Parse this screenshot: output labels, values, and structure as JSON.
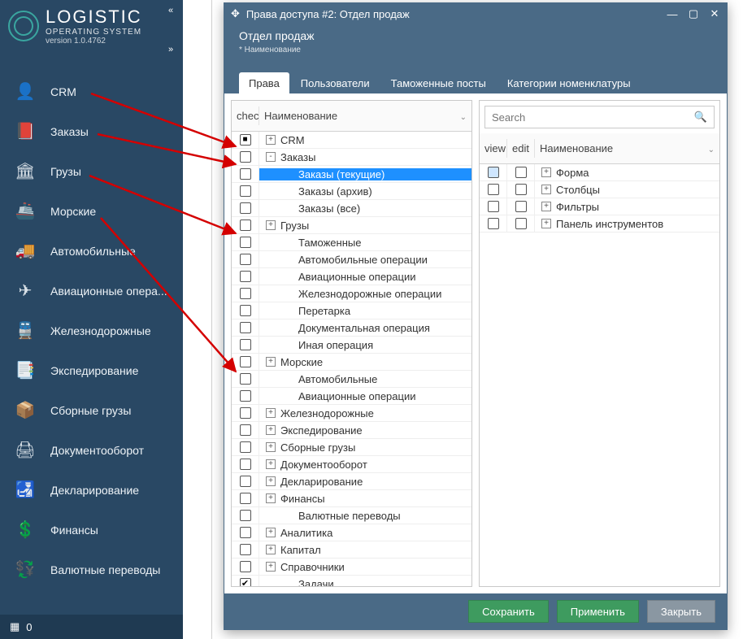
{
  "brand": {
    "title": "LOGISTIC",
    "subtitle": "OPERATING SYSTEM",
    "version": "version 1.0.4762"
  },
  "sidebar": {
    "items": [
      {
        "icon": "👤",
        "label": "CRM"
      },
      {
        "icon": "📕",
        "label": "Заказы"
      },
      {
        "icon": "🏛",
        "label": "Грузы"
      },
      {
        "icon": "🚢",
        "label": "Морские"
      },
      {
        "icon": "🚚",
        "label": "Автомобильные"
      },
      {
        "icon": "✈",
        "label": "Авиационные опера..."
      },
      {
        "icon": "🚆",
        "label": "Железнодорожные"
      },
      {
        "icon": "📑",
        "label": "Экспедирование"
      },
      {
        "icon": "📦",
        "label": "Сборные грузы"
      },
      {
        "icon": "🖨",
        "label": "Документооборот"
      },
      {
        "icon": "🛃",
        "label": "Декларирование"
      },
      {
        "icon": "💲",
        "label": "Финансы"
      },
      {
        "icon": "💱",
        "label": "Валютные переводы"
      }
    ],
    "footer_count": "0"
  },
  "dialog": {
    "title": "Права доступа #2: Отдел продаж",
    "subtitle": "Отдел продаж",
    "caption": "* Наименование",
    "tabs": [
      "Права",
      "Пользователи",
      "Таможенные посты",
      "Категории номенклатуры"
    ],
    "active_tab": 0,
    "left": {
      "col_check": "check",
      "col_name": "Наименование",
      "rows": [
        {
          "depth": 0,
          "exp": "+",
          "label": "CRM",
          "state": "square"
        },
        {
          "depth": 0,
          "exp": "-",
          "label": "Заказы",
          "state": ""
        },
        {
          "depth": 1,
          "exp": "",
          "label": "Заказы (текущие)",
          "state": "",
          "selected": true
        },
        {
          "depth": 1,
          "exp": "",
          "label": "Заказы (архив)",
          "state": ""
        },
        {
          "depth": 1,
          "exp": "",
          "label": "Заказы (все)",
          "state": ""
        },
        {
          "depth": 0,
          "exp": "+",
          "label": "Грузы",
          "state": ""
        },
        {
          "depth": 1,
          "exp": "",
          "label": "Таможенные",
          "state": ""
        },
        {
          "depth": 1,
          "exp": "",
          "label": "Автомобильные операции",
          "state": ""
        },
        {
          "depth": 1,
          "exp": "",
          "label": "Авиационные операции",
          "state": ""
        },
        {
          "depth": 1,
          "exp": "",
          "label": "Железнодорожные операции",
          "state": ""
        },
        {
          "depth": 1,
          "exp": "",
          "label": "Перетарка",
          "state": ""
        },
        {
          "depth": 1,
          "exp": "",
          "label": "Документальная операция",
          "state": ""
        },
        {
          "depth": 1,
          "exp": "",
          "label": "Иная операция",
          "state": ""
        },
        {
          "depth": 0,
          "exp": "+",
          "label": "Морские",
          "state": ""
        },
        {
          "depth": 1,
          "exp": "",
          "label": "Автомобильные",
          "state": ""
        },
        {
          "depth": 1,
          "exp": "",
          "label": "Авиационные операции",
          "state": ""
        },
        {
          "depth": 0,
          "exp": "+",
          "label": "Железнодорожные",
          "state": ""
        },
        {
          "depth": 0,
          "exp": "+",
          "label": "Экспедирование",
          "state": ""
        },
        {
          "depth": 0,
          "exp": "+",
          "label": "Сборные грузы",
          "state": ""
        },
        {
          "depth": 0,
          "exp": "+",
          "label": "Документооборот",
          "state": ""
        },
        {
          "depth": 0,
          "exp": "+",
          "label": "Декларирование",
          "state": ""
        },
        {
          "depth": 0,
          "exp": "+",
          "label": "Финансы",
          "state": ""
        },
        {
          "depth": 1,
          "exp": "",
          "label": "Валютные переводы",
          "state": ""
        },
        {
          "depth": 0,
          "exp": "+",
          "label": "Аналитика",
          "state": ""
        },
        {
          "depth": 0,
          "exp": "+",
          "label": "Капитал",
          "state": ""
        },
        {
          "depth": 0,
          "exp": "+",
          "label": "Справочники",
          "state": ""
        },
        {
          "depth": 1,
          "exp": "",
          "label": "Задачи",
          "state": "checked"
        }
      ]
    },
    "right": {
      "search_placeholder": "Search",
      "col_view": "view",
      "col_edit": "edit",
      "col_name": "Наименование",
      "rows": [
        {
          "label": "Форма",
          "exp": "+",
          "view_sel": true
        },
        {
          "label": "Столбцы",
          "exp": "+"
        },
        {
          "label": "Фильтры",
          "exp": "+"
        },
        {
          "label": "Панель инструментов",
          "exp": "+"
        }
      ]
    },
    "buttons": {
      "save": "Сохранить",
      "apply": "Применить",
      "close": "Закрыть"
    }
  }
}
